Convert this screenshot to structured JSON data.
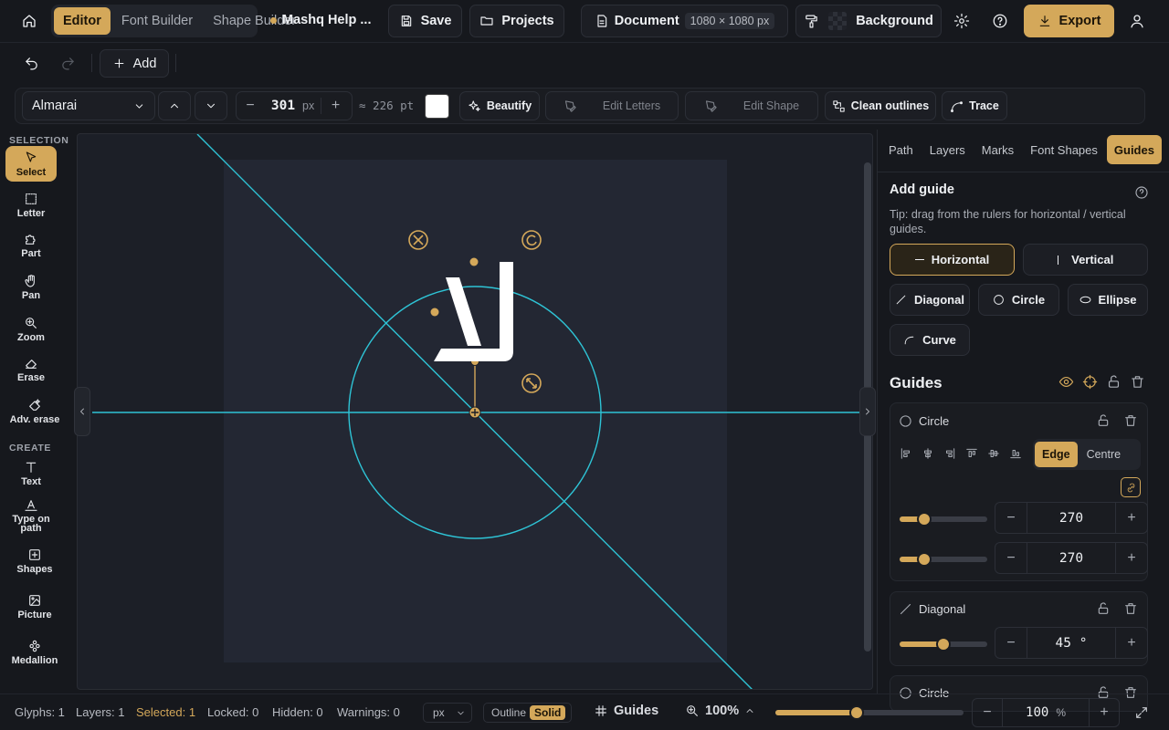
{
  "topbar": {
    "tabs": [
      {
        "label": "Editor",
        "active": true
      },
      {
        "label": "Font Builder",
        "active": false
      },
      {
        "label": "Shape Builder",
        "active": false
      }
    ],
    "project_name": "Mashq Help ...",
    "save_label": "Save",
    "projects_label": "Projects",
    "document_label": "Document",
    "document_size": "1080 × 1080 px",
    "background_label": "Background",
    "export_label": "Export"
  },
  "row2": {
    "add_label": "Add"
  },
  "toolbar": {
    "font_name": "Almarai",
    "size_value": "301",
    "size_unit": "px",
    "pt_equiv": "≈ 226 pt",
    "beautify_label": "Beautify",
    "edit_letters_label": "Edit Letters",
    "edit_shape_label": "Edit Shape",
    "clean_outlines_label": "Clean outlines",
    "trace_label": "Trace"
  },
  "left_tools": {
    "selection_title": "SELECTION",
    "create_title": "CREATE",
    "items": [
      {
        "label": "Select",
        "icon": "cursor-icon"
      },
      {
        "label": "Letter",
        "icon": "letter-select-icon"
      },
      {
        "label": "Part",
        "icon": "puzzle-icon"
      },
      {
        "label": "Pan",
        "icon": "hand-icon"
      },
      {
        "label": "Zoom",
        "icon": "zoom-icon"
      },
      {
        "label": "Erase",
        "icon": "eraser-icon"
      },
      {
        "label": "Adv. erase",
        "icon": "adv-eraser-icon"
      },
      {
        "label": "Text",
        "icon": "text-icon"
      },
      {
        "label": "Type on path",
        "icon": "type-on-path-icon"
      },
      {
        "label": "Shapes",
        "icon": "shapes-icon"
      },
      {
        "label": "Picture",
        "icon": "picture-icon"
      },
      {
        "label": "Medallion",
        "icon": "medallion-icon"
      }
    ]
  },
  "canvas": {
    "glyph_text": "لاً",
    "guide_color": "#2ec4d6",
    "accent": "#d4a85a"
  },
  "right_panel": {
    "tabs": [
      {
        "label": "Path",
        "active": false
      },
      {
        "label": "Layers",
        "active": false
      },
      {
        "label": "Marks",
        "active": false
      },
      {
        "label": "Font Shapes",
        "active": false
      },
      {
        "label": "Guides",
        "active": true
      }
    ],
    "add_guide_title": "Add guide",
    "tip": "Tip: drag from the rulers for horizontal / vertical guides.",
    "guide_buttons": {
      "horizontal": "Horizontal",
      "vertical": "Vertical",
      "diagonal": "Diagonal",
      "circle": "Circle",
      "ellipse": "Ellipse",
      "curve": "Curve"
    },
    "guides_title": "Guides",
    "guide1": {
      "name": "Circle",
      "mode_edge": "Edge",
      "mode_centre": "Centre",
      "value1": "270",
      "value2": "270",
      "slider1": 0.28,
      "slider2": 0.28
    },
    "guide2": {
      "name": "Diagonal",
      "value": "45 °",
      "slider": 0.5
    },
    "guide3": {
      "name": "Circle"
    }
  },
  "statusbar": {
    "glyphs": "Glyphs: 1",
    "layers": "Layers: 1",
    "selected": "Selected: 1",
    "locked": "Locked: 0",
    "hidden": "Hidden: 0",
    "warnings": "Warnings: 0",
    "unit": "px",
    "outline_label": "Outline",
    "solid_label": "Solid",
    "guides_label": "Guides",
    "zoom_label": "100%",
    "zoom_value": "100",
    "zoom_unit": "%",
    "zoom_slider": 0.43
  }
}
